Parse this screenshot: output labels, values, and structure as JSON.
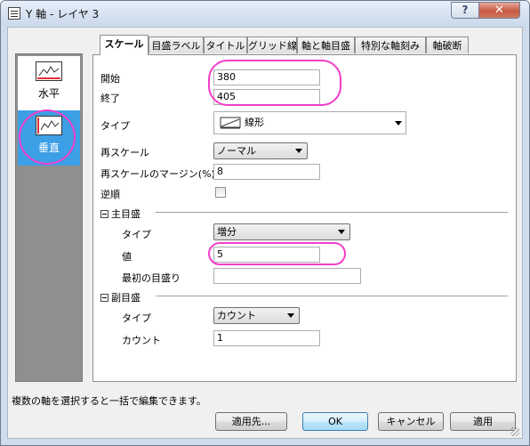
{
  "window": {
    "title": "Y 軸 - レイヤ 3",
    "help_label": "?",
    "close_label": "✕"
  },
  "sidebar": {
    "items": [
      {
        "label": "水平",
        "icon": "horizontal-axis-icon"
      },
      {
        "label": "垂直",
        "icon": "vertical-axis-icon"
      }
    ]
  },
  "tabs": [
    {
      "label": "スケール",
      "active": true
    },
    {
      "label": "目盛ラベル"
    },
    {
      "label": "タイトル"
    },
    {
      "label": "グリッド線"
    },
    {
      "label": "軸と軸目盛"
    },
    {
      "label": "特別な軸刻み"
    },
    {
      "label": "軸破断"
    }
  ],
  "scale": {
    "start_label": "開始",
    "start_value": "380",
    "end_label": "終了",
    "end_value": "405",
    "type_label": "タイプ",
    "type_value": "線形",
    "rescale_label": "再スケール",
    "rescale_value": "ノーマル",
    "margin_label": "再スケールのマージン(%)",
    "margin_value": "8",
    "reverse_label": "逆順"
  },
  "major": {
    "header": "主目盛",
    "type_label": "タイプ",
    "type_value": "増分",
    "value_label": "値",
    "value_value": "5",
    "first_label": "最初の目盛り",
    "first_value": ""
  },
  "minor": {
    "header": "副目盛",
    "type_label": "タイプ",
    "type_value": "カウント",
    "count_label": "カウント",
    "count_value": "1"
  },
  "status": "複数の軸を選択すると一括で編集できます。",
  "buttons": {
    "apply_to": "適用先...",
    "ok": "OK",
    "cancel": "キャンセル",
    "apply": "適用"
  },
  "colors": {
    "highlight": "#f23ec9",
    "selected": "#3d9fe6"
  }
}
